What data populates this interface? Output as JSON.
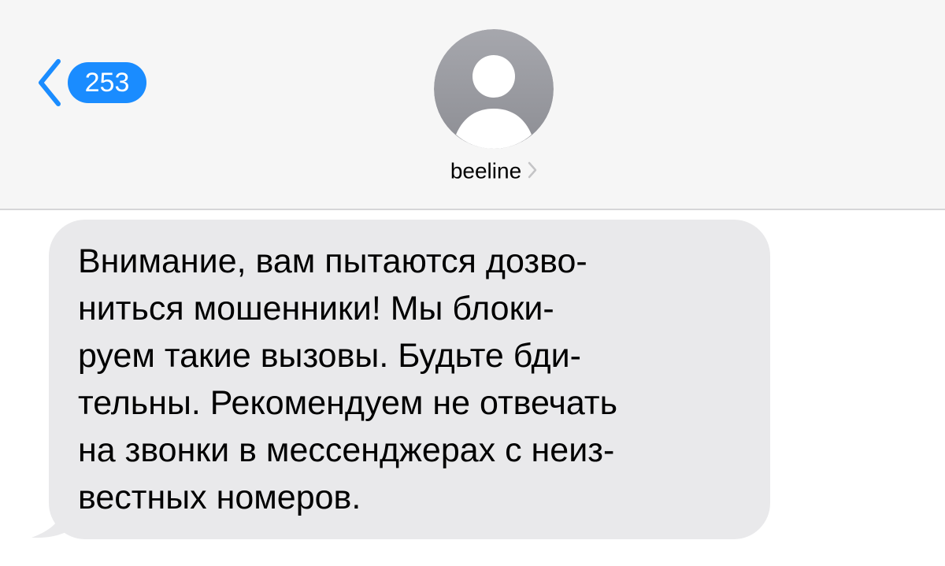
{
  "colors": {
    "header_bg": "#f6f6f6",
    "accent": "#1a8cff",
    "avatar_gray": "#9a9ba1",
    "bubble_gray": "#e9e9eb",
    "chevron_gray": "#c4c4c6"
  },
  "header": {
    "back_icon": "chevron-left-icon",
    "back_badge_count": "253",
    "avatar_icon": "person-silhouette-icon",
    "contact_name": "beeline",
    "contact_chevron_icon": "chevron-right-icon"
  },
  "message": {
    "direction": "incoming",
    "lines": [
      "Внимание, вам пытаются дозво-",
      "ниться мошенники! Мы блоки-",
      "руем такие вызовы. Будьте бди-",
      "тельны. Рекомендуем не отвечать",
      "на звонки в мессенджерах с неиз-",
      "вестных номеров."
    ]
  }
}
